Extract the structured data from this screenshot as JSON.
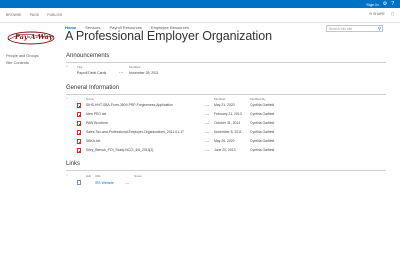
{
  "suite": {
    "sign_in": "Sign In",
    "icon_gear": "gear-icon",
    "icon_help": "help-icon"
  },
  "ribbon": {
    "tabs": [
      "BROWSE",
      "PAGE",
      "PUBLISH"
    ],
    "share": "SHARE",
    "focus": "FOCUS"
  },
  "logo": {
    "text": "Pay-A-Way"
  },
  "topnav": [
    "Home",
    "Services",
    "Payroll Resources",
    "Employee Resources"
  ],
  "page_title": "A Professional Employer Organization",
  "search": {
    "placeholder": "Search this site"
  },
  "quicklaunch": [
    "People and Groups",
    "Site Contents"
  ],
  "announcements": {
    "title": "Announcements",
    "columns": {
      "title": "Title",
      "modified": "Modified"
    },
    "rows": [
      {
        "title": "Payroll Debit Cards",
        "modified": "November 28, 2011"
      }
    ]
  },
  "general": {
    "title": "General Information",
    "columns": {
      "name": "Name",
      "modified": "Modified",
      "modified_by": "Modified By"
    },
    "rows": [
      {
        "name": "SIHS-HHT-SBA-Form-3509-PRP-Forgiveness-Application",
        "modified": "May 21, 2020",
        "by": "Cynthia Garfield"
      },
      {
        "name": "New PEO tax",
        "modified": "February 21, 2013",
        "by": "Cynthia Garfield"
      },
      {
        "name": "PAW Brochure",
        "modified": "October 31, 2014",
        "by": "Cynthia Garfield"
      },
      {
        "name": "Sales-Tax-and-Professional-Employer-Organizations_2011-01-17",
        "modified": "November 8, 2011",
        "by": "Cynthia Garfield"
      },
      {
        "name": "SBKA-tat",
        "modified": "May 26, 2020",
        "by": "Cynthia Garfield"
      },
      {
        "name": "Kiley_Bernck_POI_Study-NCCI_40t_2013[1]",
        "modified": "June 20, 2013",
        "by": "Cynthia Garfield"
      }
    ]
  },
  "links": {
    "title": "Links",
    "columns": {
      "edit": "Edit",
      "url": "URL",
      "notes": "Notes"
    },
    "rows": [
      {
        "url": "IRS Website",
        "notes": ""
      }
    ]
  },
  "colors": {
    "accent": "#0072c6",
    "suite_bar": "#0072c6",
    "doc_icon": "#c7342b"
  }
}
